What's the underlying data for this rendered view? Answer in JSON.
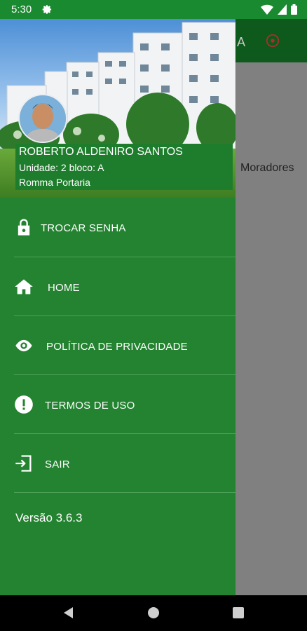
{
  "status_bar": {
    "time": "5:30"
  },
  "background_app": {
    "toolbar_letter": "A",
    "content_text": "Moradores"
  },
  "drawer": {
    "user": {
      "name": "ROBERTO ALDENIRO SANTOS",
      "unit": "Unidade: 2 bloco: A",
      "condo": "Romma Portaria"
    },
    "menu": [
      {
        "label": "TROCAR SENHA",
        "icon": "lock-icon"
      },
      {
        "label": "HOME",
        "icon": "home-icon"
      },
      {
        "label": "POLÍTICA DE PRIVACIDADE",
        "icon": "eye-icon"
      },
      {
        "label": "TERMOS DE USO",
        "icon": "alert-icon"
      },
      {
        "label": "SAIR",
        "icon": "logout-icon"
      }
    ],
    "version": "Versão 3.6.3"
  },
  "colors": {
    "drawer": "#238330",
    "status_bar": "#1a8a30",
    "scrim": "#808080"
  }
}
